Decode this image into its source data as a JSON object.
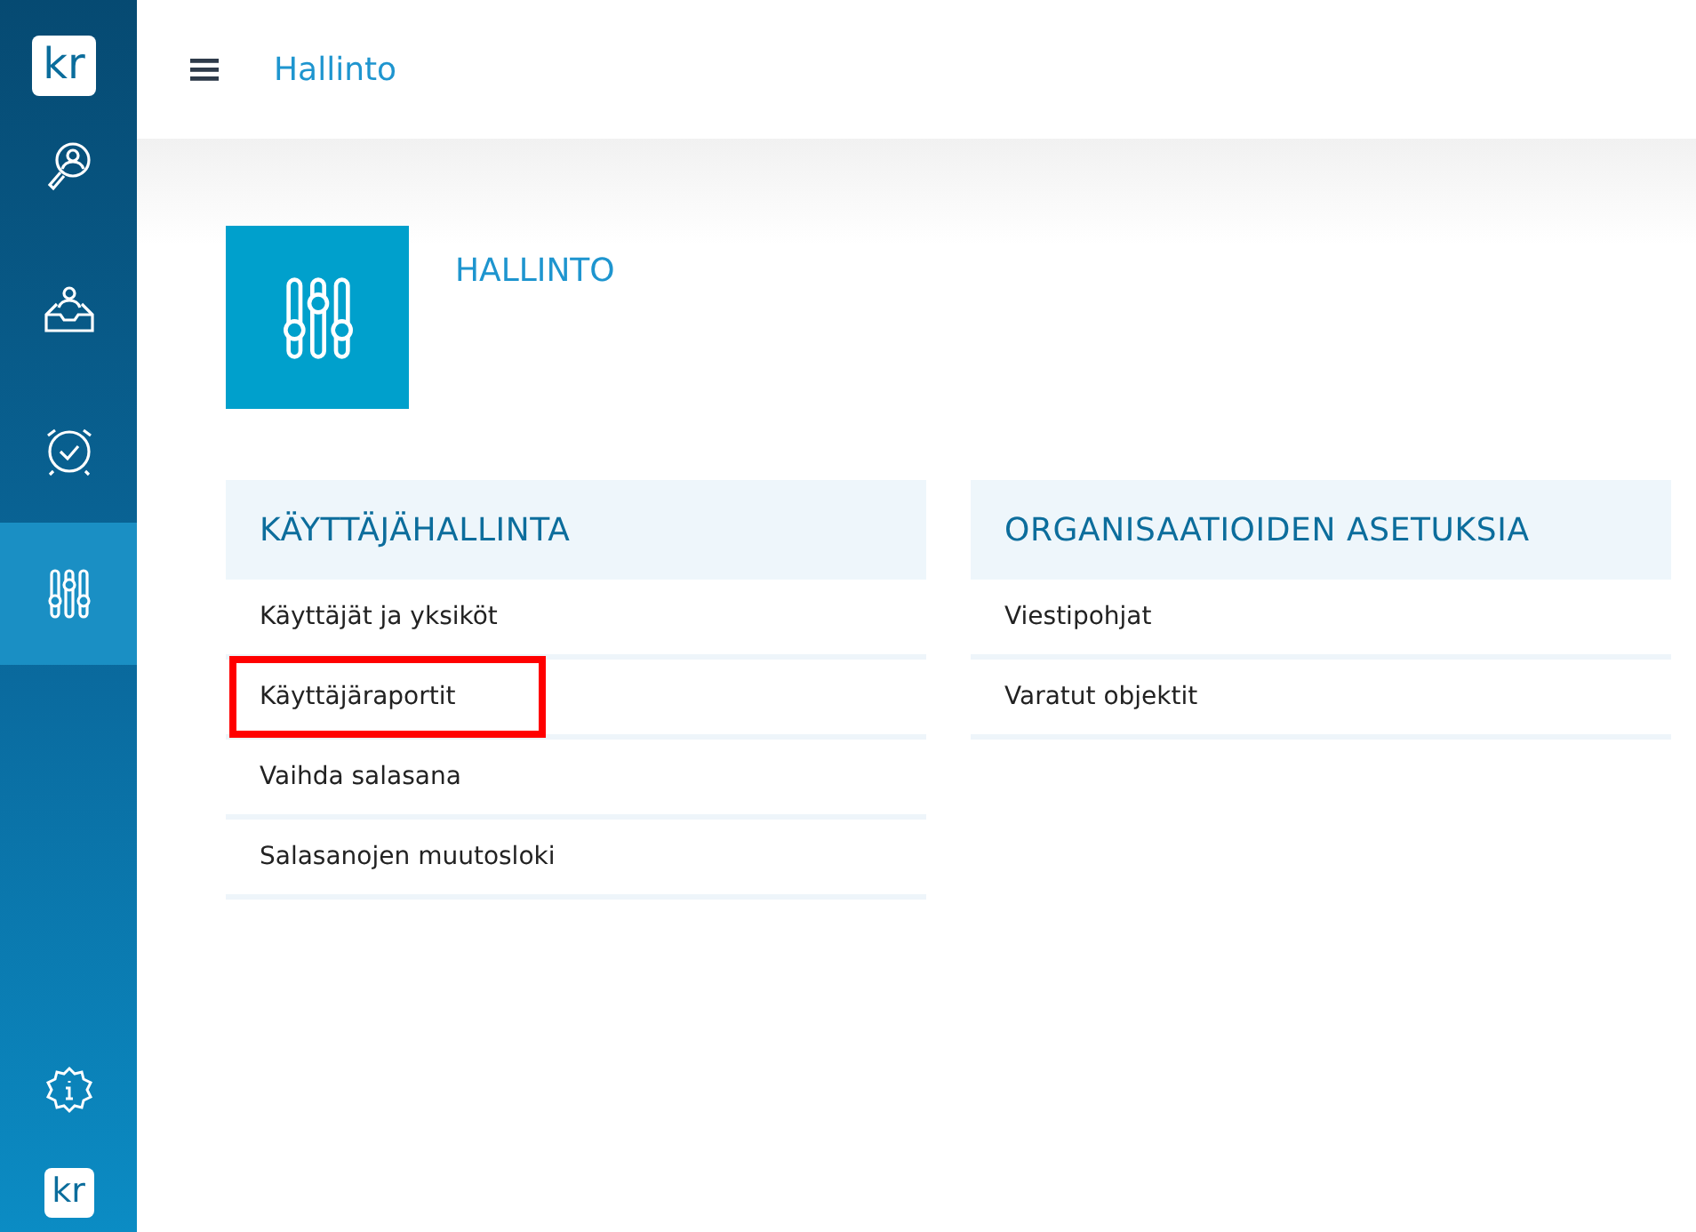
{
  "sidebar": {
    "logo": "kr",
    "items": [
      {
        "kind": "search-person",
        "selected": false
      },
      {
        "kind": "inbox",
        "selected": false
      },
      {
        "kind": "alarm",
        "selected": false
      },
      {
        "kind": "sliders",
        "selected": true
      }
    ],
    "footer_logo": "kr"
  },
  "header": {
    "title": "Hallinto"
  },
  "page": {
    "title": "HALLINTO"
  },
  "sections": [
    {
      "title": "KÄYTTÄJÄHALLINTA",
      "items": [
        {
          "label": "Käyttäjät ja yksiköt",
          "highlighted": false
        },
        {
          "label": "Käyttäjäraportit",
          "highlighted": true
        },
        {
          "label": "Vaihda salasana",
          "highlighted": false
        },
        {
          "label": "Salasanojen muutosloki",
          "highlighted": false
        }
      ]
    },
    {
      "title": "ORGANISAATIOIDEN ASETUKSIA",
      "items": [
        {
          "label": "Viestipohjat",
          "highlighted": false
        },
        {
          "label": "Varatut objektit",
          "highlighted": false
        }
      ]
    }
  ]
}
